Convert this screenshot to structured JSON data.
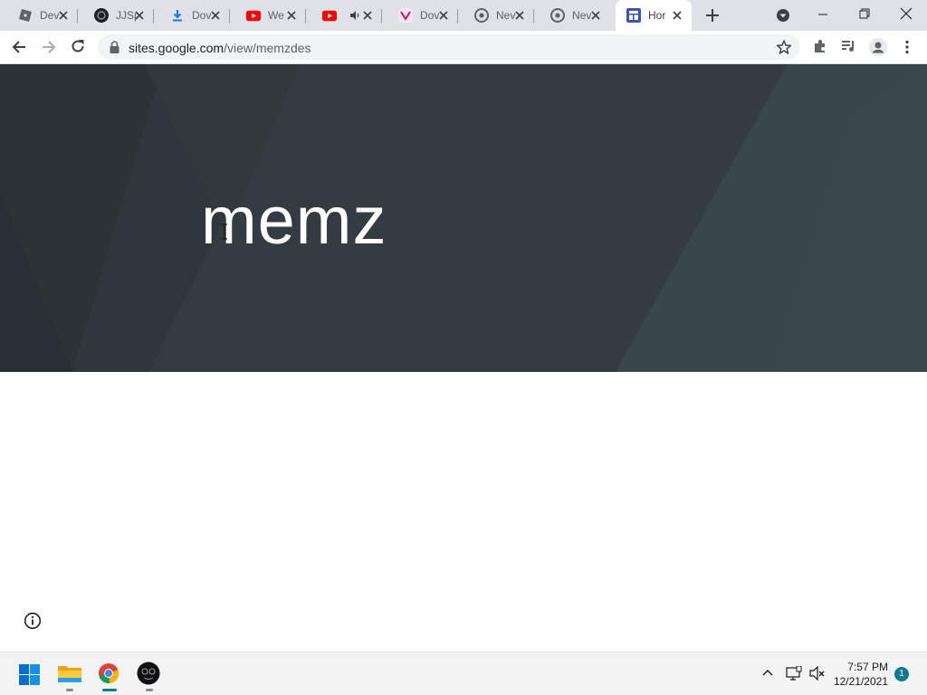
{
  "browser": {
    "tabs": [
      {
        "label": "Dev",
        "icon": "roblox-icon"
      },
      {
        "label": "JJSp",
        "icon": "site-logo-icon"
      },
      {
        "label": "Dov",
        "icon": "download-icon"
      },
      {
        "label": "We",
        "icon": "youtube-icon"
      },
      {
        "label": "",
        "icon": "youtube-icon",
        "audio": true
      },
      {
        "label": "Dov",
        "icon": "vectorizer-icon"
      },
      {
        "label": "Nev",
        "icon": "chrome-icon"
      },
      {
        "label": "Nev",
        "icon": "chrome-icon"
      },
      {
        "label": "Hor",
        "icon": "google-sites-icon",
        "active": true
      }
    ],
    "url_host": "sites.google.com",
    "url_path": "/view/memzdes"
  },
  "page": {
    "title": "memz"
  },
  "taskbar": {
    "time": "7:57 PM",
    "date": "12/21/2021",
    "notification_count": "1"
  },
  "colors": {
    "hero_background": "#333c41",
    "tab_strip": "#dee1e6",
    "taskbar": "#f3f3f3",
    "notification_badge": "#0f7b8f"
  }
}
